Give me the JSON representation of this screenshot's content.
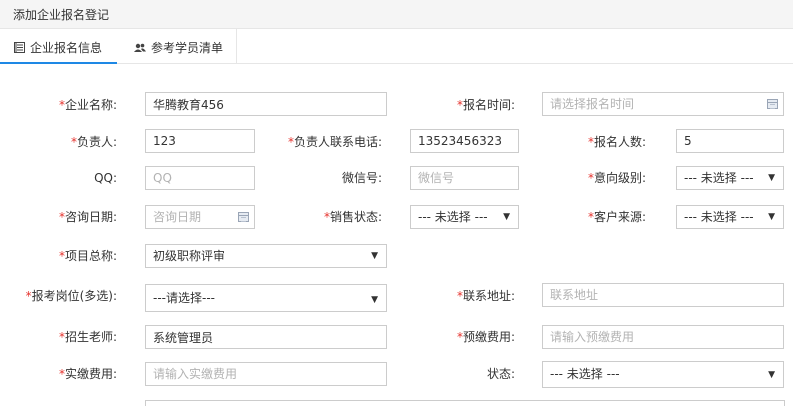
{
  "window": {
    "title": "添加企业报名登记"
  },
  "tabs": [
    {
      "label": "企业报名信息",
      "icon": "list-icon",
      "active": true
    },
    {
      "label": "参考学员清单",
      "icon": "users-icon",
      "active": false
    }
  ],
  "form": {
    "company_name": {
      "label": "企业名称:",
      "required": "*",
      "value": "华腾教育456"
    },
    "signup_time": {
      "label": "报名时间:",
      "required": "*",
      "placeholder": "请选择报名时间"
    },
    "contact_person": {
      "label": "负责人:",
      "required": "*",
      "value": "123"
    },
    "contact_phone": {
      "label": "负责人联系电话:",
      "required": "*",
      "value": "13523456323"
    },
    "signup_count": {
      "label": "报名人数:",
      "required": "*",
      "value": "5"
    },
    "qq": {
      "label": "QQ:",
      "placeholder": "QQ"
    },
    "wechat": {
      "label": "微信号:",
      "placeholder": "微信号"
    },
    "intent_level": {
      "label": "意向级别:",
      "required": "*",
      "value": "--- 未选择 ---"
    },
    "consult_date": {
      "label": "咨询日期:",
      "required": "*",
      "placeholder": "咨询日期"
    },
    "sales_status": {
      "label": "销售状态:",
      "required": "*",
      "value": "--- 未选择 ---"
    },
    "customer_source": {
      "label": "客户来源:",
      "required": "*",
      "value": "--- 未选择 ---"
    },
    "project": {
      "label": "项目总称:",
      "required": "*",
      "value": "初级职称评审"
    },
    "position": {
      "label": "报考岗位(多选):",
      "required": "*",
      "value": "---请选择---"
    },
    "address": {
      "label": "联系地址:",
      "required": "*",
      "placeholder": "联系地址"
    },
    "teacher": {
      "label": "招生老师:",
      "required": "*",
      "value": "系统管理员"
    },
    "prepaid_fee": {
      "label": "预缴费用:",
      "required": "*",
      "placeholder": "请输入预缴费用"
    },
    "paid_fee": {
      "label": "实缴费用:",
      "required": "*",
      "placeholder": "请输入实缴费用"
    },
    "status": {
      "label": "状态:",
      "value": "--- 未选择 ---"
    }
  },
  "icons": {
    "dropdown": "▼",
    "calendar": "calendar-icon"
  },
  "colors": {
    "required": "#e5322d",
    "active_tab": "#1e88e5",
    "border": "#cccccc"
  }
}
